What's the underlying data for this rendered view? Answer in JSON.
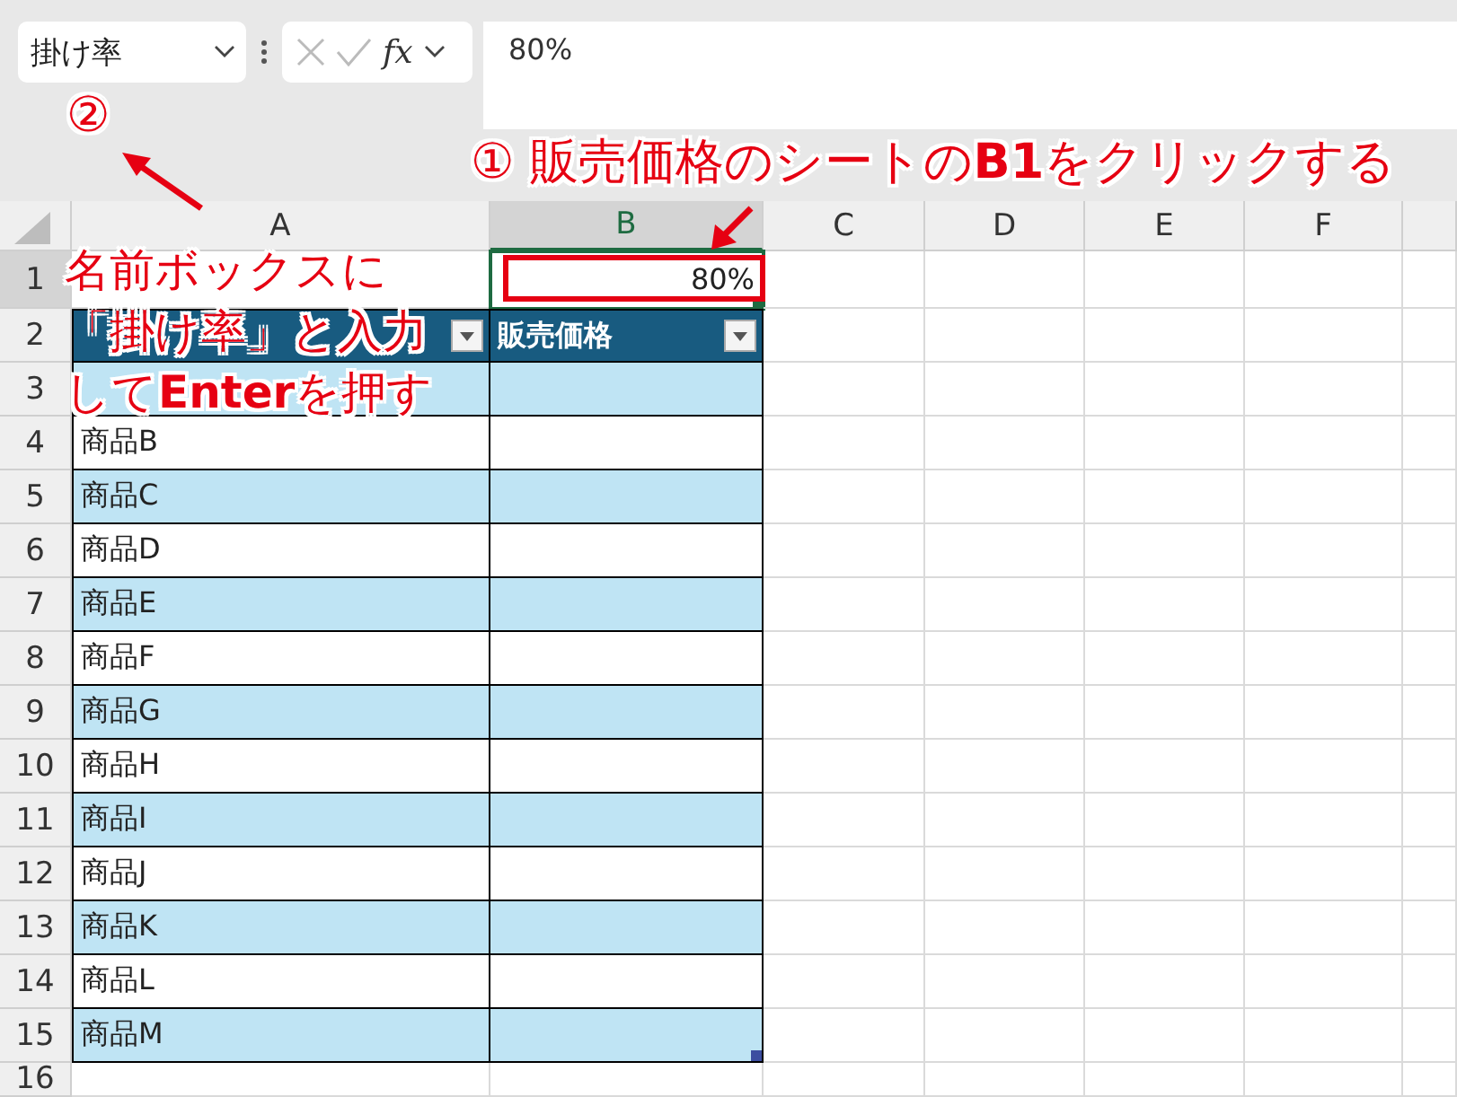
{
  "formula_bar": {
    "name_box": "掛け率",
    "function_label": "fx",
    "formula": "80%"
  },
  "sheet": {
    "columns": [
      {
        "label": "A",
        "selected": false
      },
      {
        "label": "B",
        "selected": true
      },
      {
        "label": "C",
        "selected": false
      },
      {
        "label": "D",
        "selected": false
      },
      {
        "label": "E",
        "selected": false
      },
      {
        "label": "F",
        "selected": false
      }
    ],
    "rows": [
      {
        "label": "1",
        "selected": true
      },
      {
        "label": "2",
        "selected": false
      },
      {
        "label": "3",
        "selected": false
      },
      {
        "label": "4",
        "selected": false
      },
      {
        "label": "5",
        "selected": false
      },
      {
        "label": "6",
        "selected": false
      },
      {
        "label": "7",
        "selected": false
      },
      {
        "label": "8",
        "selected": false
      },
      {
        "label": "9",
        "selected": false
      },
      {
        "label": "10",
        "selected": false
      },
      {
        "label": "11",
        "selected": false
      },
      {
        "label": "12",
        "selected": false
      },
      {
        "label": "13",
        "selected": false
      },
      {
        "label": "14",
        "selected": false
      },
      {
        "label": "15",
        "selected": false
      },
      {
        "label": "16",
        "selected": false
      }
    ],
    "cell_b1": {
      "value": "80%",
      "selected": true
    },
    "table": {
      "header": [
        {
          "filter": true
        },
        {
          "label": "販売価格",
          "filter": true
        }
      ],
      "rows": [
        {
          "banded": true
        },
        {
          "item": "商品B",
          "banded": false
        },
        {
          "item": "商品C",
          "banded": true
        },
        {
          "item": "商品D",
          "banded": false
        },
        {
          "item": "商品E",
          "banded": true
        },
        {
          "item": "商品F",
          "banded": false
        },
        {
          "item": "商品G",
          "banded": true
        },
        {
          "item": "商品H",
          "banded": false
        },
        {
          "item": "商品I",
          "banded": true
        },
        {
          "item": "商品J",
          "banded": false
        },
        {
          "item": "商品K",
          "banded": true
        },
        {
          "item": "商品L",
          "banded": false
        },
        {
          "item": "商品M",
          "banded": true
        }
      ]
    }
  },
  "annotations": {
    "step1": "① 販売価格のシートの**B1**をクリックする",
    "step2_number": "②",
    "step2_lines": [
      "名前ボックスに",
      "「掛け率」と入力",
      "して**Enter**を押す"
    ]
  }
}
